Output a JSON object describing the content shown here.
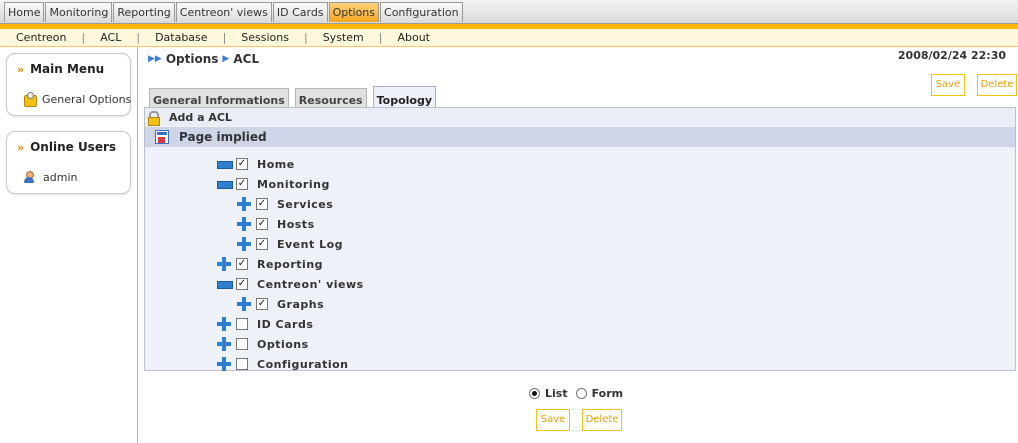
{
  "top_tabs": [
    {
      "label": "Home",
      "active": false
    },
    {
      "label": "Monitoring",
      "active": false
    },
    {
      "label": "Reporting",
      "active": false
    },
    {
      "label": "Centreon' views",
      "active": false
    },
    {
      "label": "ID Cards",
      "active": false
    },
    {
      "label": "Options",
      "active": true
    },
    {
      "label": "Configuration",
      "active": false
    }
  ],
  "sub_nav": [
    "Centreon",
    "ACL",
    "Database",
    "Sessions",
    "System",
    "About"
  ],
  "sidebar": {
    "main_menu": {
      "title": "Main Menu",
      "items": [
        "General Options"
      ]
    },
    "online_users": {
      "title": "Online Users",
      "users": [
        "admin"
      ]
    }
  },
  "breadcrumb": [
    "Options",
    "ACL"
  ],
  "datetime": "2008/02/24 22:30",
  "buttons": {
    "save": "Save",
    "delete": "Delete"
  },
  "form_tabs": [
    {
      "label": "General Informations",
      "active": false
    },
    {
      "label": "Resources",
      "active": false
    },
    {
      "label": "Topology",
      "active": true
    }
  ],
  "panel": {
    "header": "Add a ACL",
    "subheader": "Page implied"
  },
  "tree": [
    {
      "label": "Home",
      "expanded": true,
      "checked": true,
      "level": 0
    },
    {
      "label": "Monitoring",
      "expanded": true,
      "checked": true,
      "level": 0
    },
    {
      "label": "Services",
      "expanded": false,
      "checked": true,
      "level": 1
    },
    {
      "label": "Hosts",
      "expanded": false,
      "checked": true,
      "level": 1
    },
    {
      "label": "Event Log",
      "expanded": false,
      "checked": true,
      "level": 1
    },
    {
      "label": "Reporting",
      "expanded": false,
      "checked": true,
      "level": 0
    },
    {
      "label": "Centreon' views",
      "expanded": true,
      "checked": true,
      "level": 0
    },
    {
      "label": "Graphs",
      "expanded": false,
      "checked": true,
      "level": 1
    },
    {
      "label": "ID Cards",
      "expanded": false,
      "checked": false,
      "level": 0
    },
    {
      "label": "Options",
      "expanded": false,
      "checked": false,
      "level": 0
    },
    {
      "label": "Configuration",
      "expanded": false,
      "checked": false,
      "level": 0
    }
  ],
  "view_mode": {
    "list_label": "List",
    "form_label": "Form",
    "selected": "List"
  }
}
